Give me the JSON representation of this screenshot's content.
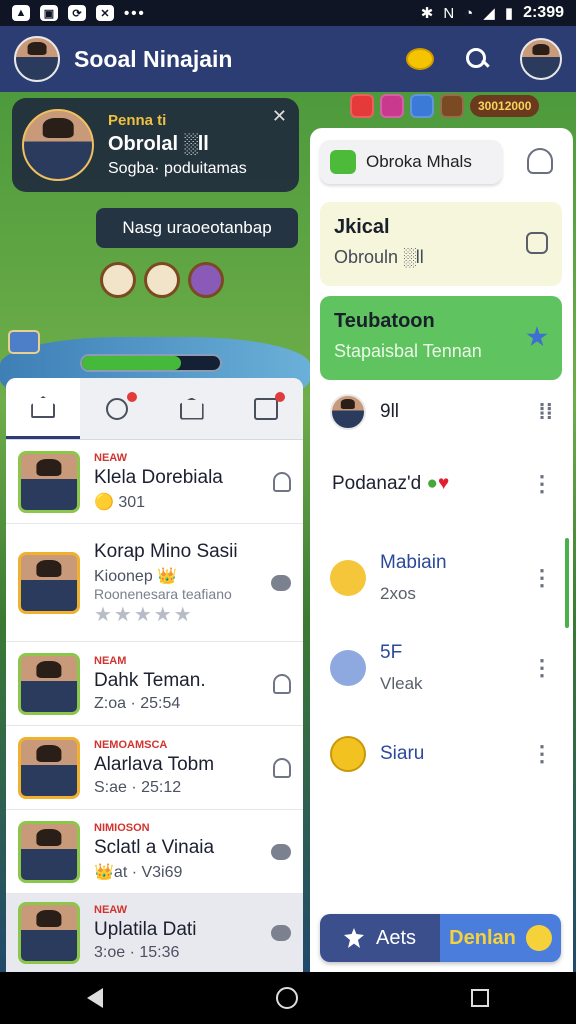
{
  "statusbar": {
    "time": "2:399"
  },
  "appbar": {
    "title": "Sooal Ninajain"
  },
  "game": {
    "resource": "30012000",
    "profile": {
      "label": "Penna ti",
      "name": "Obrolal ░ll",
      "subtitle": "Sogba· poduitamas"
    },
    "tooltip": "Nasg uraoeotanbap",
    "timer_progress": 0.72
  },
  "tabs": [
    {
      "name": "home",
      "badge": false
    },
    {
      "name": "search",
      "badge": true
    },
    {
      "name": "mail",
      "badge": false
    },
    {
      "name": "inbox",
      "badge": true
    }
  ],
  "friends": [
    {
      "tag": "NEAW",
      "name": "Klela Dorebiala",
      "sub": "🟡 301",
      "sub2": "",
      "stars": false,
      "action": "bell",
      "height": 84
    },
    {
      "tag": "",
      "name": "Korap Mino Sasii",
      "sub": "Kioonep 👑",
      "sub2": "Roonenesara teafiano",
      "stars": true,
      "action": "chat",
      "height": 118
    },
    {
      "tag": "NEAM",
      "name": "Dahk Teman.",
      "sub": "Z:oa · 25:54",
      "sub2": "",
      "stars": false,
      "action": "bell",
      "height": 84
    },
    {
      "tag": "NEMOAMSCA",
      "name": "Alarlava Tobm",
      "sub": "S:ae · 25:12",
      "sub2": "",
      "stars": false,
      "action": "bell",
      "height": 84
    },
    {
      "tag": "NIMIOSON",
      "name": "Sclatl a Vinaia",
      "sub": "👑at · V3i69",
      "sub2": "",
      "stars": false,
      "action": "chat",
      "height": 84
    },
    {
      "tag": "NEAW",
      "name": "Uplatila Dati",
      "sub": "3:oe · 15:36",
      "sub2": "",
      "stars": false,
      "action": "chat",
      "height": 78
    }
  ],
  "right_panel": {
    "search_label": "Obroka Mhals",
    "card1": {
      "title": "Jkical",
      "sub": "Obrouln ░ll"
    },
    "card2": {
      "title": "Teubatoon",
      "sub": "Stapaisbal Tennan"
    },
    "rows": [
      {
        "title": "9ll",
        "sub": ""
      },
      {
        "title": "Podanaz'd",
        "sub": ""
      },
      {
        "title": "Mabiain",
        "sub": "2xos"
      },
      {
        "title": "5F",
        "sub": "Vleak"
      },
      {
        "title": "Siaru",
        "sub": ""
      }
    ],
    "bottom": {
      "left": "Aets",
      "right": "Denlan"
    }
  }
}
